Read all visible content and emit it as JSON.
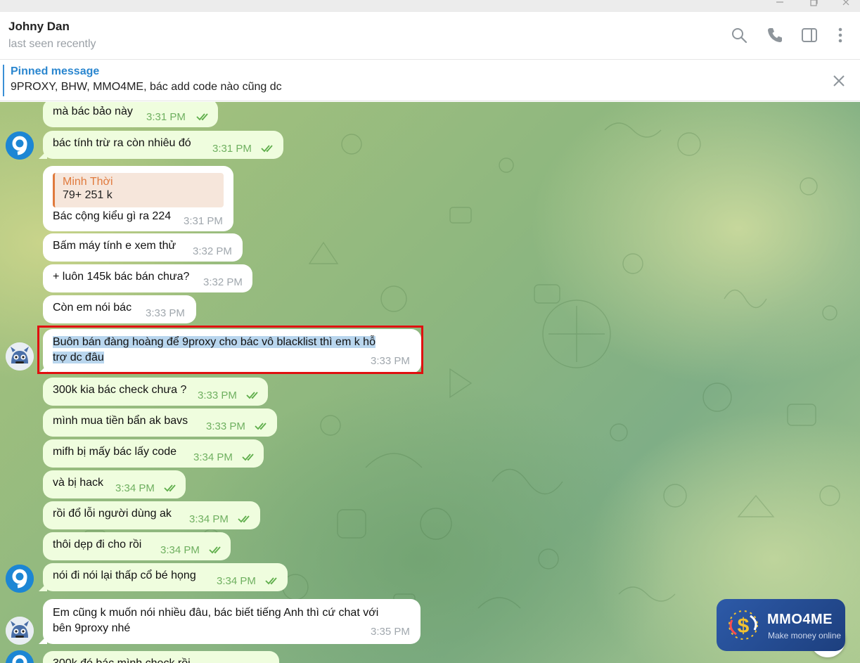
{
  "window": {
    "minimize_icon": "minimize-icon",
    "maximize_icon": "maximize-icon",
    "close_icon": "close-icon"
  },
  "header": {
    "name": "Johny Dan",
    "status": "last seen recently",
    "icons": [
      "search-icon",
      "phone-icon",
      "sidebar-toggle-icon",
      "more-vert-icon"
    ]
  },
  "pinned": {
    "title": "Pinned message",
    "text": "9PROXY, BHW, MMO4ME, bác add code nào cũng dc"
  },
  "messages": [
    {
      "text": "mà bác bảo này",
      "time": "3:31 PM",
      "out": true
    },
    {
      "text": "bác tính trừ ra còn nhiêu đó",
      "time": "3:31 PM",
      "out": true
    },
    {
      "reply_name": "Minh Thời",
      "reply_text": "79+ 251 k",
      "text": "Bác cộng kiểu gì ra 224",
      "time": "3:31 PM",
      "out": false
    },
    {
      "text": "Bấm máy tính e xem thử",
      "time": "3:32 PM",
      "out": false
    },
    {
      "text": "+ luôn 145k bác bán chưa?",
      "time": "3:32 PM",
      "out": false
    },
    {
      "text": "Còn em nói bác",
      "time": "3:33 PM",
      "out": false
    },
    {
      "text_line1": "Buôn bán đàng hoàng để 9proxy cho bác vô blacklist thì em k hỗ",
      "text_line2": "trợ dc đâu",
      "time": "3:33 PM",
      "out": false
    },
    {
      "text": "300k kia bác check chưa ?",
      "time": "3:33 PM",
      "out": true
    },
    {
      "text": "mình mua tiền bẩn ak bavs",
      "time": "3:33 PM",
      "out": true
    },
    {
      "text": "mifh bị mấy bác lấy code",
      "time": "3:34 PM",
      "out": true
    },
    {
      "text": "và bị hack",
      "time": "3:34 PM",
      "out": true
    },
    {
      "text": "rồi đổ lỗi người dùng ak",
      "time": "3:34 PM",
      "out": true
    },
    {
      "text": "thôi dẹp đi cho rồi",
      "time": "3:34 PM",
      "out": true
    },
    {
      "text": "nói đi nói lại thấp cổ bé họng",
      "time": "3:34 PM",
      "out": true
    },
    {
      "text_line1": "Em cũng k muốn nói nhiều đâu, bác biết tiếng Anh thì cứ chat với",
      "text_line2": "bên 9proxy nhé",
      "time": "3:35 PM",
      "out": false
    },
    {
      "text": "300k đó bác mình check rồi",
      "time": "",
      "out": true
    }
  ],
  "watermark": {
    "title": "MMO4ME",
    "subtitle": "Make money online"
  },
  "colors": {
    "accent": "#2a86cf",
    "out_bubble": "#effdde",
    "in_bubble": "#ffffff",
    "highlight": "#e01010",
    "selection": "#b9d6ee"
  }
}
